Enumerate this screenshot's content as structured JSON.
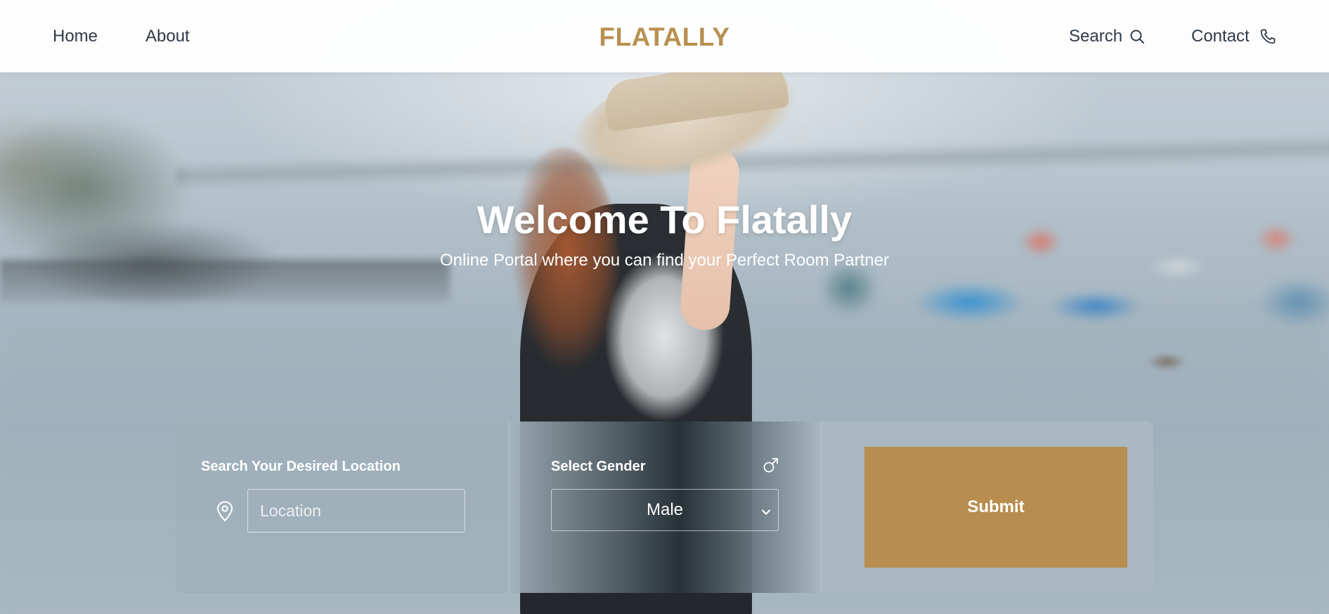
{
  "nav": {
    "links": [
      "Home",
      "About"
    ],
    "brand": "FLATALLY",
    "search_label": "Search",
    "contact_label": "Contact",
    "icons": [
      "search-icon",
      "phone-icon"
    ]
  },
  "hero": {
    "title": "Welcome To Flatally",
    "subtitle": "Online Portal where you can find your Perfect Room Partner"
  },
  "search_form": {
    "location_label": "Search Your Desired Location",
    "location_placeholder": "Location",
    "location_icon": "map-pin-icon",
    "gender_label": "Select Gender",
    "gender_icon": "male-symbol-icon",
    "gender_selected": "Male",
    "submit_label": "Submit"
  },
  "colors": {
    "brand": "#b8904f",
    "submit_button": "#b78e4f",
    "nav_text": "#2f3a47"
  }
}
